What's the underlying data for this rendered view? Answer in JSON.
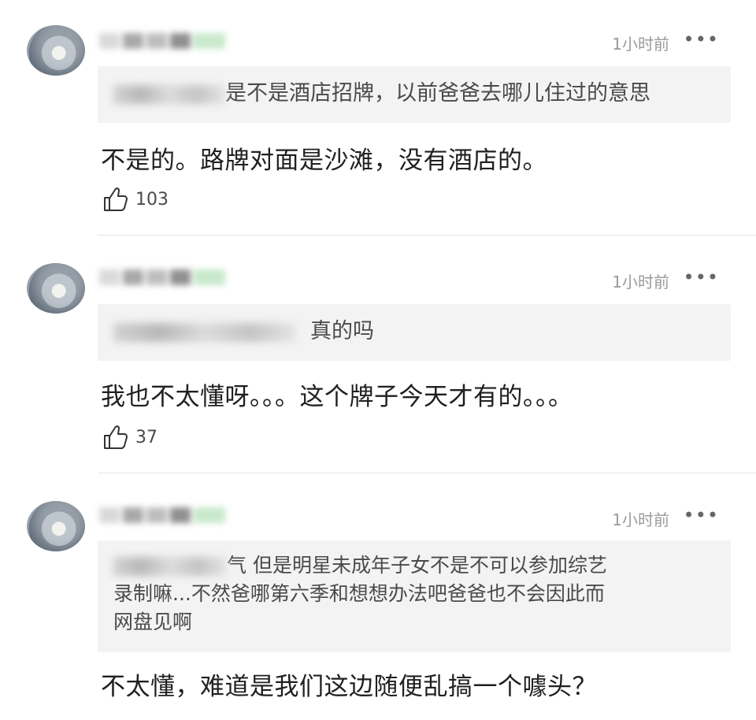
{
  "comments": [
    {
      "time": "1小时前",
      "more": "•••",
      "quote_text": "是不是酒店招牌，以前爸爸去哪儿住过的意思",
      "body": "不是的。路牌对面是沙滩，没有酒店的。",
      "likes": "103"
    },
    {
      "time": "1小时前",
      "more": "•••",
      "quote_text": "真的吗",
      "body": "我也不太懂呀。。。这个牌子今天才有的。。。",
      "likes": "37"
    },
    {
      "time": "1小时前",
      "more": "•••",
      "quote_text_line1": "气 但是明星未成年子女不是不可以参加综艺",
      "quote_text_line2": "录制嘛...不然爸哪第六季和想想办法吧爸爸也不会因此而",
      "quote_text_line3": "网盘见啊",
      "body": "不太懂，难道是我们这边随便乱搞一个噱头？"
    }
  ],
  "icons": {
    "like": "thumbs-up-icon",
    "more": "more-dots-icon",
    "avatar": "avatar-image"
  },
  "colors": {
    "time": "#9a9a9a",
    "quote_bg": "#f3f3f3",
    "name_green": "#9bd7a4"
  }
}
